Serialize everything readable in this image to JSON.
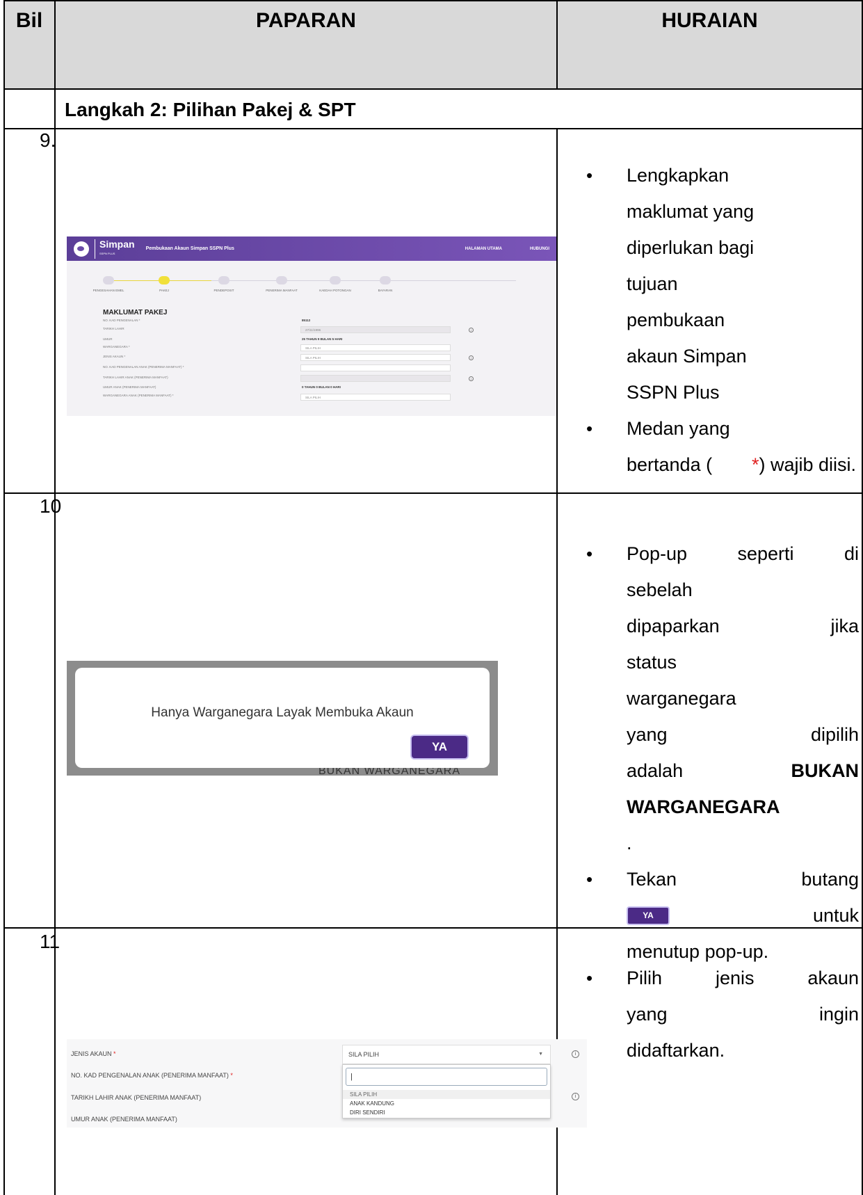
{
  "table": {
    "headers": {
      "bil": "Bil",
      "paparan": "PAPARAN",
      "huraian": "HURAIAN"
    },
    "section_title": "Langkah 2: Pilihan Pakej & SPT"
  },
  "rows": [
    {
      "bil": "9.",
      "bullets": {
        "b1": "Lengkapkan maklumat yang diperlukan bagi tujuan pembukaan akaun Simpan SSPN Plus",
        "b2_pre": "Medan yang bertanda (",
        "b2_star": "*",
        "b2_post": ") wajib diisi."
      }
    },
    {
      "bil": "10",
      "bullets": {
        "b1_lines": [
          "Pop-up seperti di",
          "sebelah",
          "dipaparkan jika",
          "status",
          "warganegara",
          "yang dipilih",
          "adalah"
        ],
        "b1_bold1": "BUKAN",
        "b1_bold2": "WARGANEGARA",
        "b1_end": ".",
        "b2_pre": "Tekan butang",
        "b2_btn": "YA",
        "b2_post": "untuk",
        "b2_end": "menutup pop-up."
      }
    },
    {
      "bil": "11",
      "bullets": {
        "b1_lines": [
          "Pilih jenis akaun",
          "yang ingin",
          "didaftarkan."
        ]
      }
    }
  ],
  "shot1": {
    "brand": "Simpan",
    "brand_sub": "SSPN PLUS",
    "title": "Pembukaan Akaun Simpan SSPN Plus",
    "nav": [
      "HALAMAN UTAMA",
      "HUBUNGI"
    ],
    "steps": [
      "PENGESAHAN EMEL",
      "PAKEJ",
      "PENDEPOSIT",
      "PENERIMA MANFAAT",
      "KAEDAH POTONGAN",
      "BAYARAN"
    ],
    "form_title": "MAKLUMAT PAKEJ",
    "fields": [
      {
        "label": "NO. KAD PENGENALAN *",
        "value": "85112"
      },
      {
        "label": "TARIKH LAHIR",
        "value": "27/11/1996"
      },
      {
        "label": "UMUR",
        "value": "25 TAHUN 9 BULAN 5 HARI"
      },
      {
        "label": "WARGANEGARA *",
        "value": "SILA PILIH"
      },
      {
        "label": "JENIS AKAUN *",
        "value": "SILA PILIH"
      },
      {
        "label": "NO. KAD PENGENALAN ANAK (PENERIMA MANFAAT) *",
        "value": ""
      },
      {
        "label": "TARIKH LAHIR ANAK (PENERIMA MANFAAT)",
        "value": ""
      },
      {
        "label": "UMUR ANAK (PENERIMA MANFAAT)",
        "value": "0 TAHUN 0 BULAN 0 HARI"
      },
      {
        "label": "WARGANEGARA ANAK (PENERIMA MANFAAT) *",
        "value": "SILA PILIH"
      }
    ]
  },
  "shot2": {
    "message": "Hanya Warganegara Layak Membuka Akaun",
    "button": "YA",
    "under_text": "BUKAN WARGANEGARA"
  },
  "shot3": {
    "labels": [
      {
        "pre": "JENIS AKAUN",
        "star": " *"
      },
      {
        "pre": "NO. KAD PENGENALAN ANAK (PENERIMA MANFAAT)",
        "star": " *"
      },
      {
        "pre": "TARIKH LAHIR ANAK (PENERIMA MANFAAT)",
        "star": ""
      },
      {
        "pre": "UMUR ANAK (PENERIMA MANFAAT)",
        "star": ""
      }
    ],
    "select_value": "SILA PILIH",
    "search_value": "|",
    "options": [
      "SILA PILIH",
      "ANAK KANDUNG",
      "DIRI SENDIRI"
    ]
  },
  "colors": {
    "header_bg": "#d9d9d9",
    "purple": "#4b2a86",
    "required_star": "#e02020"
  }
}
